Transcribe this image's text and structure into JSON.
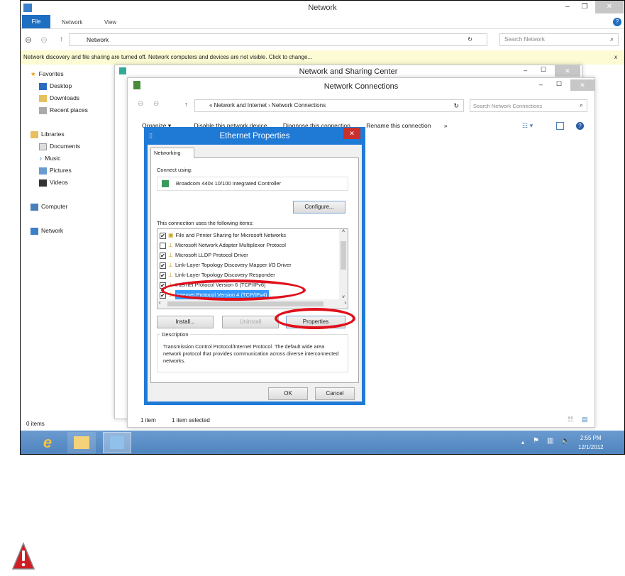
{
  "explorer": {
    "title": "Network",
    "tabs": [
      "File",
      "Network",
      "View"
    ],
    "breadcrumb": "Network",
    "search_placeholder": "Search Network",
    "info_bar": "Network discovery and file sharing are turned off. Network computers and devices are not visible. Click to change...",
    "nav": {
      "favorites": "Favorites",
      "desktop": "Desktop",
      "downloads": "Downloads",
      "recent": "Recent places",
      "libraries": "Libraries",
      "documents": "Documents",
      "music": "Music",
      "pictures": "Pictures",
      "videos": "Videos",
      "computer": "Computer",
      "network": "Network"
    },
    "status": "0 items"
  },
  "sharing_center": {
    "title": "Network and Sharing Center"
  },
  "connections": {
    "title": "Network Connections",
    "breadcrumb_parent": "Network and Internet",
    "breadcrumb_current": "Network Connections",
    "search_placeholder": "Search Network Connections",
    "toolbar": [
      "Organize ▾",
      "Disable this network device",
      "Diagnose this connection",
      "Rename this connection",
      "»"
    ],
    "status_count": "1 item",
    "status_selected": "1 item selected"
  },
  "dialog": {
    "title": "Ethernet Properties",
    "tab": "Networking",
    "connect_using_label": "Connect using:",
    "adapter": "Broadcom 440x 10/100 Integrated Controller",
    "configure": "Configure...",
    "items_label": "This connection uses the following items:",
    "items": [
      {
        "label": "File and Printer Sharing for Microsoft Networks",
        "checked": true
      },
      {
        "label": "Microsoft Network Adapter Multiplexor Protocol",
        "checked": false
      },
      {
        "label": "Microsoft LLDP Protocol Driver",
        "checked": true
      },
      {
        "label": "Link-Layer Topology Discovery Mapper I/O Driver",
        "checked": true
      },
      {
        "label": "Link-Layer Topology Discovery Responder",
        "checked": true
      },
      {
        "label": "Internet Protocol Version 6 (TCP/IPv6)",
        "checked": true
      },
      {
        "label": "Internet Protocol Version 4 (TCP/IPv4)",
        "checked": true,
        "selected": true
      }
    ],
    "install": "Install...",
    "uninstall": "Uninstall",
    "properties": "Properties",
    "description_label": "Description",
    "description": "Transmission Control Protocol/Internet Protocol. The default wide area network protocol that provides communication across diverse interconnected networks.",
    "ok": "OK",
    "cancel": "Cancel"
  },
  "taskbar": {
    "time": "2:55 PM",
    "date": "12/1/2012"
  },
  "highlight_color": "#e0101c"
}
